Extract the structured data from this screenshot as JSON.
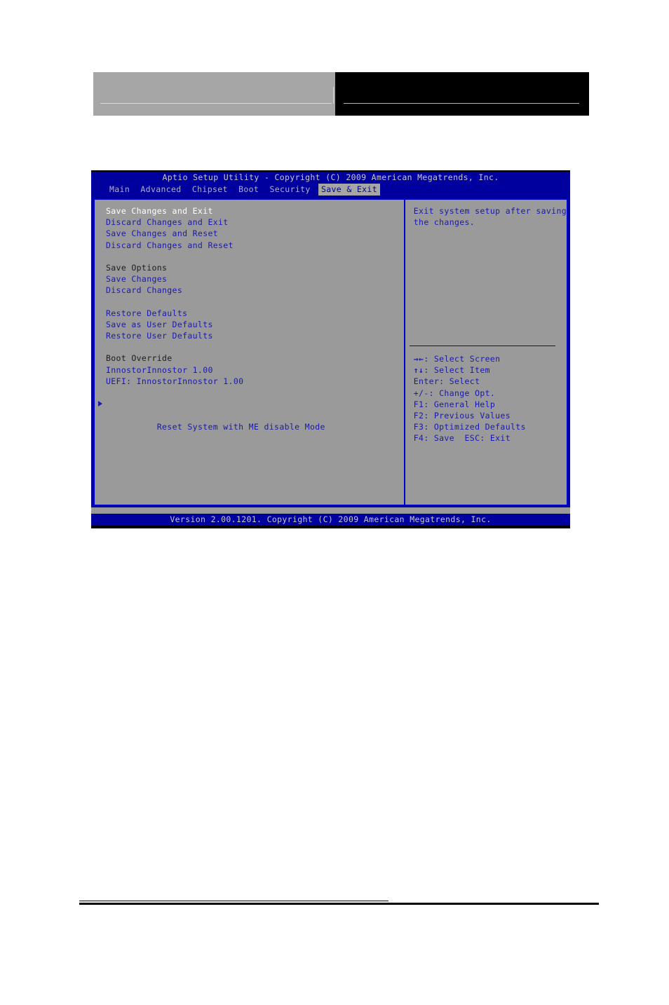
{
  "bios": {
    "title": "Aptio Setup Utility - Copyright (C) 2009 American Megatrends, Inc.",
    "version_line": "Version 2.00.1201. Copyright (C) 2009 American Megatrends, Inc.",
    "tabs": [
      {
        "label": "Main",
        "active": false
      },
      {
        "label": "Advanced",
        "active": false
      },
      {
        "label": "Chipset",
        "active": false
      },
      {
        "label": "Boot",
        "active": false
      },
      {
        "label": "Security",
        "active": false
      },
      {
        "label": "Save & Exit",
        "active": true
      }
    ],
    "menu": [
      {
        "label": "Save Changes and Exit",
        "kind": "selected"
      },
      {
        "label": "Discard Changes and Exit",
        "kind": "item"
      },
      {
        "label": "Save Changes and Reset",
        "kind": "item"
      },
      {
        "label": "Discard Changes and Reset",
        "kind": "item"
      },
      {
        "label": "",
        "kind": "spacer"
      },
      {
        "label": "Save Options",
        "kind": "section"
      },
      {
        "label": "Save Changes",
        "kind": "item"
      },
      {
        "label": "Discard Changes",
        "kind": "item"
      },
      {
        "label": "",
        "kind": "spacer"
      },
      {
        "label": "Restore Defaults",
        "kind": "item"
      },
      {
        "label": "Save as User Defaults",
        "kind": "item"
      },
      {
        "label": "Restore User Defaults",
        "kind": "item"
      },
      {
        "label": "",
        "kind": "spacer"
      },
      {
        "label": "Boot Override",
        "kind": "section"
      },
      {
        "label": "InnostorInnostor 1.00",
        "kind": "item"
      },
      {
        "label": "UEFI: InnostorInnostor 1.00",
        "kind": "item"
      },
      {
        "label": "",
        "kind": "spacer"
      },
      {
        "label": "Reset System with ME disable Mode",
        "kind": "submenu"
      }
    ],
    "help": {
      "lines": [
        "Exit system setup after saving",
        "the changes."
      ],
      "keys": [
        {
          "glyph": "→←",
          "text": ": Select Screen"
        },
        {
          "glyph": "↑↓",
          "text": ": Select Item"
        },
        {
          "glyph": "",
          "text": "Enter: Select"
        },
        {
          "glyph": "",
          "text": "+/-: Change Opt."
        },
        {
          "glyph": "",
          "text": "F1: General Help"
        },
        {
          "glyph": "",
          "text": "F2: Previous Values"
        },
        {
          "glyph": "",
          "text": "F3: Optimized Defaults"
        },
        {
          "glyph": "",
          "text": "F4: Save  ESC: Exit"
        }
      ]
    },
    "colors": {
      "screen_blue": "#00009e",
      "panel_gray": "#9a9a9a",
      "item_blue": "#1a1aaa",
      "selected_white": "#ffffff",
      "section_dark": "#1c1c1c",
      "border_blue": "#0000cd",
      "title_gray": "#c8c8c8"
    }
  }
}
